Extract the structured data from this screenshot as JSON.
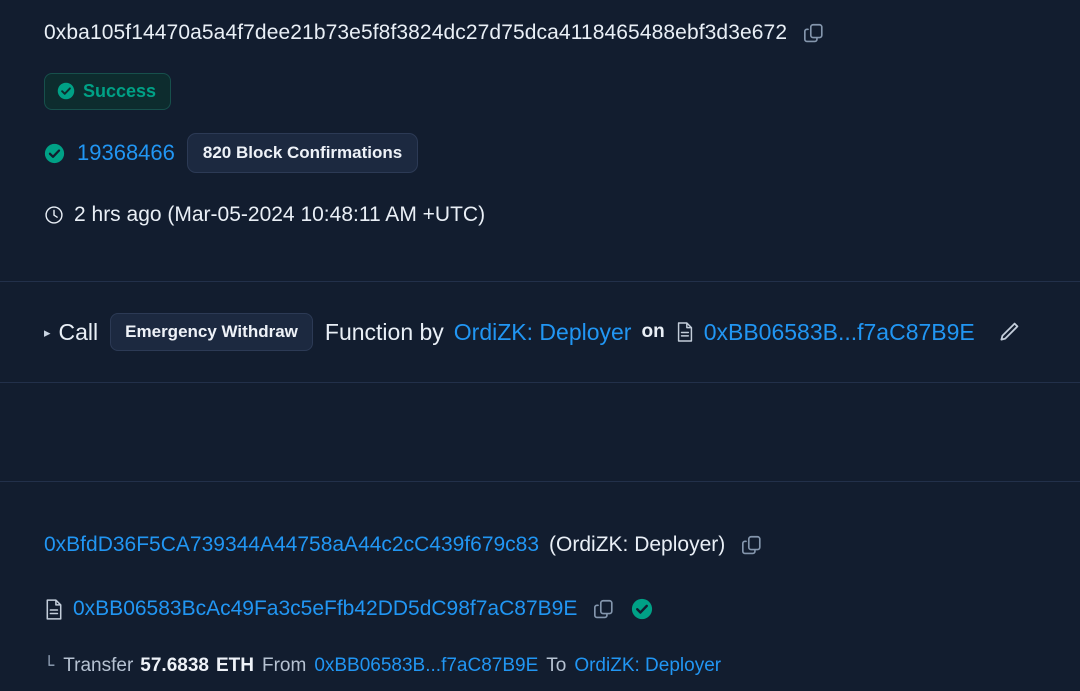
{
  "transaction": {
    "hash": "0xba105f14470a5a4f7dee21b73e5f8f3824dc27d75dca4118465488ebf3d3e672",
    "copy_icon": "copy-icon",
    "status": {
      "label": "Success",
      "icon": "check-circle-icon",
      "color": "#00a186",
      "bg": "#0d2c2e",
      "border": "#17504c"
    },
    "block": {
      "icon": "check-circle-icon",
      "number": "19368466",
      "confirmations": "820 Block Confirmations",
      "link_color": "#2196f3"
    },
    "timestamp": {
      "icon": "clock-icon",
      "text": "2 hrs ago (Mar-05-2024 10:48:11 AM +UTC)"
    }
  },
  "action": {
    "caret": "▸",
    "call_word": "Call",
    "function_name": "Emergency Withdraw",
    "function_word": "Function by",
    "caller": "OrdiZK: Deployer",
    "on_word": "on",
    "contract_short": "0xBB06583B...f7aC87B9E",
    "contract_icon": "document-icon",
    "edit_icon": "pencil-icon"
  },
  "parties": {
    "from": {
      "address": "0xBfdD36F5CA739344A44758aA44c2cC439f679c83",
      "alias": "(OrdiZK: Deployer)",
      "copy_icon": "copy-icon"
    },
    "to": {
      "icon": "document-icon",
      "address": "0xBB06583BcAc49Fa3c5eFfb42DD5dC98f7aC87B9E",
      "copy_icon": "copy-icon",
      "verified_icon": "check-circle-icon"
    }
  },
  "transfer": {
    "corner": "└",
    "label": "Transfer",
    "amount": "57.6838",
    "unit": "ETH",
    "from_word": "From",
    "from_address": "0xBB06583B...f7aC87B9E",
    "to_word": "To",
    "to_address": "OrdiZK: Deployer"
  },
  "theme": {
    "background": "#121d2f",
    "divider": "#22304a",
    "link": "#2196f3",
    "text": "#e9eff6",
    "success": "#00a186"
  }
}
